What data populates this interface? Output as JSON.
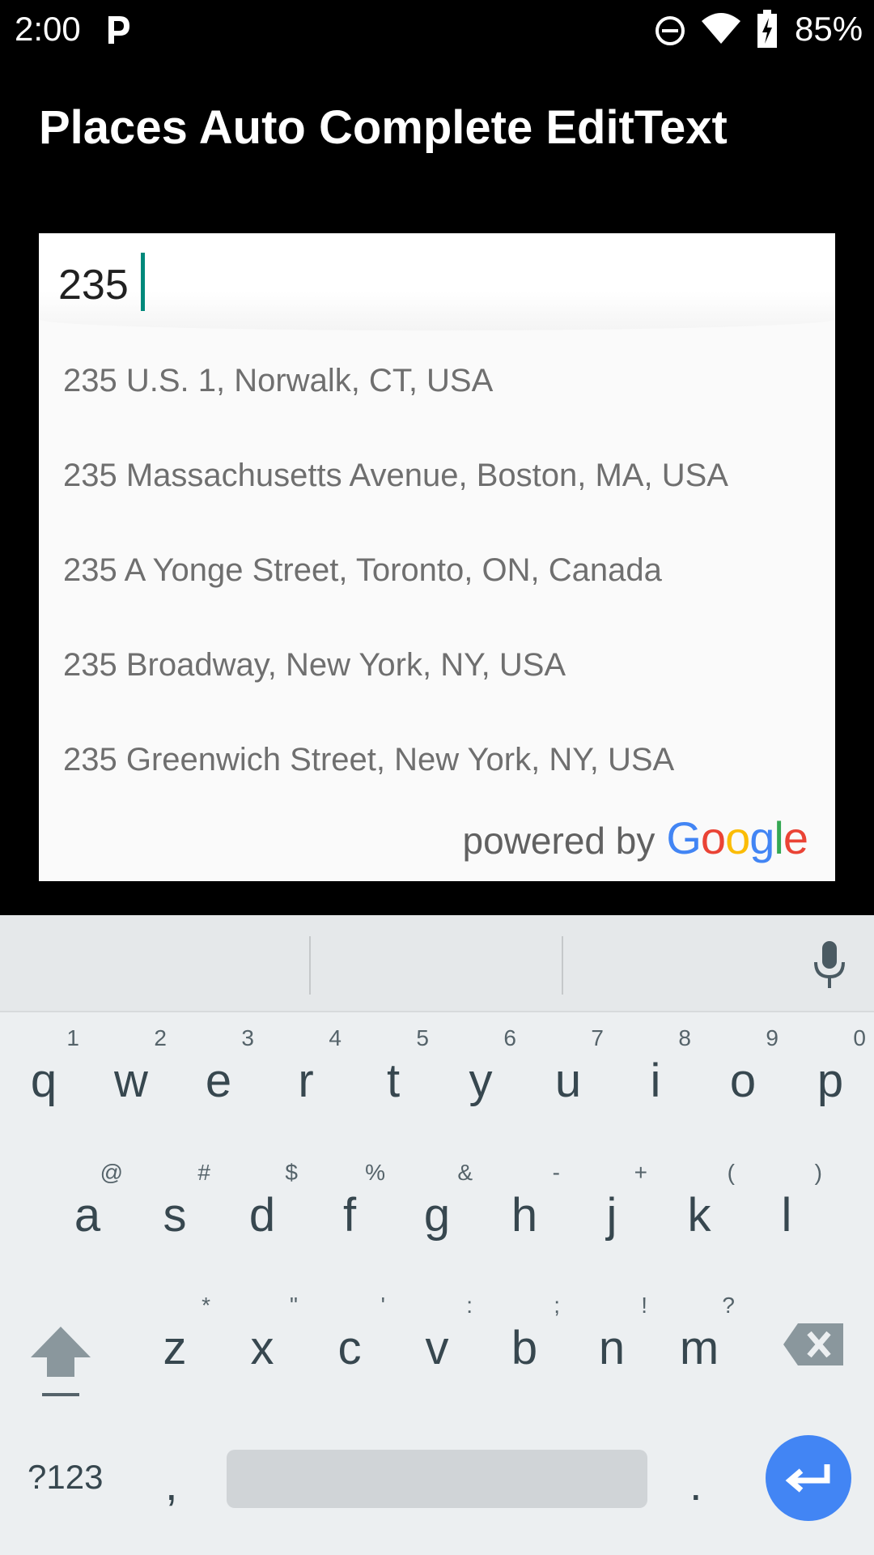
{
  "status_bar": {
    "time": "2:00",
    "battery_percent": "85%",
    "icons": [
      "parking-p-icon",
      "do-not-disturb-icon",
      "wifi-icon",
      "battery-charging-icon"
    ]
  },
  "app_bar": {
    "title": "Places Auto Complete EditText"
  },
  "search": {
    "value": "235",
    "suggestions": [
      "235 U.S. 1, Norwalk, CT, USA",
      "235 Massachusetts Avenue, Boston, MA, USA",
      "235 A Yonge Street, Toronto, ON, Canada",
      "235 Broadway, New York, NY, USA",
      "235 Greenwich Street, New York, NY, USA"
    ],
    "powered_by": "powered by",
    "google": [
      "G",
      "o",
      "o",
      "g",
      "l",
      "e"
    ],
    "google_colors": [
      "#4285f4",
      "#ea4335",
      "#fbbc05",
      "#4285f4",
      "#34a853",
      "#ea4335"
    ],
    "caret_color": "#00897b"
  },
  "keyboard": {
    "row1": [
      {
        "k": "q",
        "h": "1"
      },
      {
        "k": "w",
        "h": "2"
      },
      {
        "k": "e",
        "h": "3"
      },
      {
        "k": "r",
        "h": "4"
      },
      {
        "k": "t",
        "h": "5"
      },
      {
        "k": "y",
        "h": "6"
      },
      {
        "k": "u",
        "h": "7"
      },
      {
        "k": "i",
        "h": "8"
      },
      {
        "k": "o",
        "h": "9"
      },
      {
        "k": "p",
        "h": "0"
      }
    ],
    "row2": [
      {
        "k": "a",
        "h": "@"
      },
      {
        "k": "s",
        "h": "#"
      },
      {
        "k": "d",
        "h": "$"
      },
      {
        "k": "f",
        "h": "%"
      },
      {
        "k": "g",
        "h": "&"
      },
      {
        "k": "h",
        "h": "-"
      },
      {
        "k": "j",
        "h": "+"
      },
      {
        "k": "k",
        "h": "("
      },
      {
        "k": "l",
        "h": ")"
      }
    ],
    "row3": [
      {
        "k": "z",
        "h": "*"
      },
      {
        "k": "x",
        "h": "\""
      },
      {
        "k": "c",
        "h": "'"
      },
      {
        "k": "v",
        "h": ":"
      },
      {
        "k": "b",
        "h": ";"
      },
      {
        "k": "n",
        "h": "!"
      },
      {
        "k": "m",
        "h": "?"
      }
    ],
    "symbols_label": "?123",
    "comma_label": ",",
    "period_label": ".",
    "enter_color": "#4285f4"
  }
}
